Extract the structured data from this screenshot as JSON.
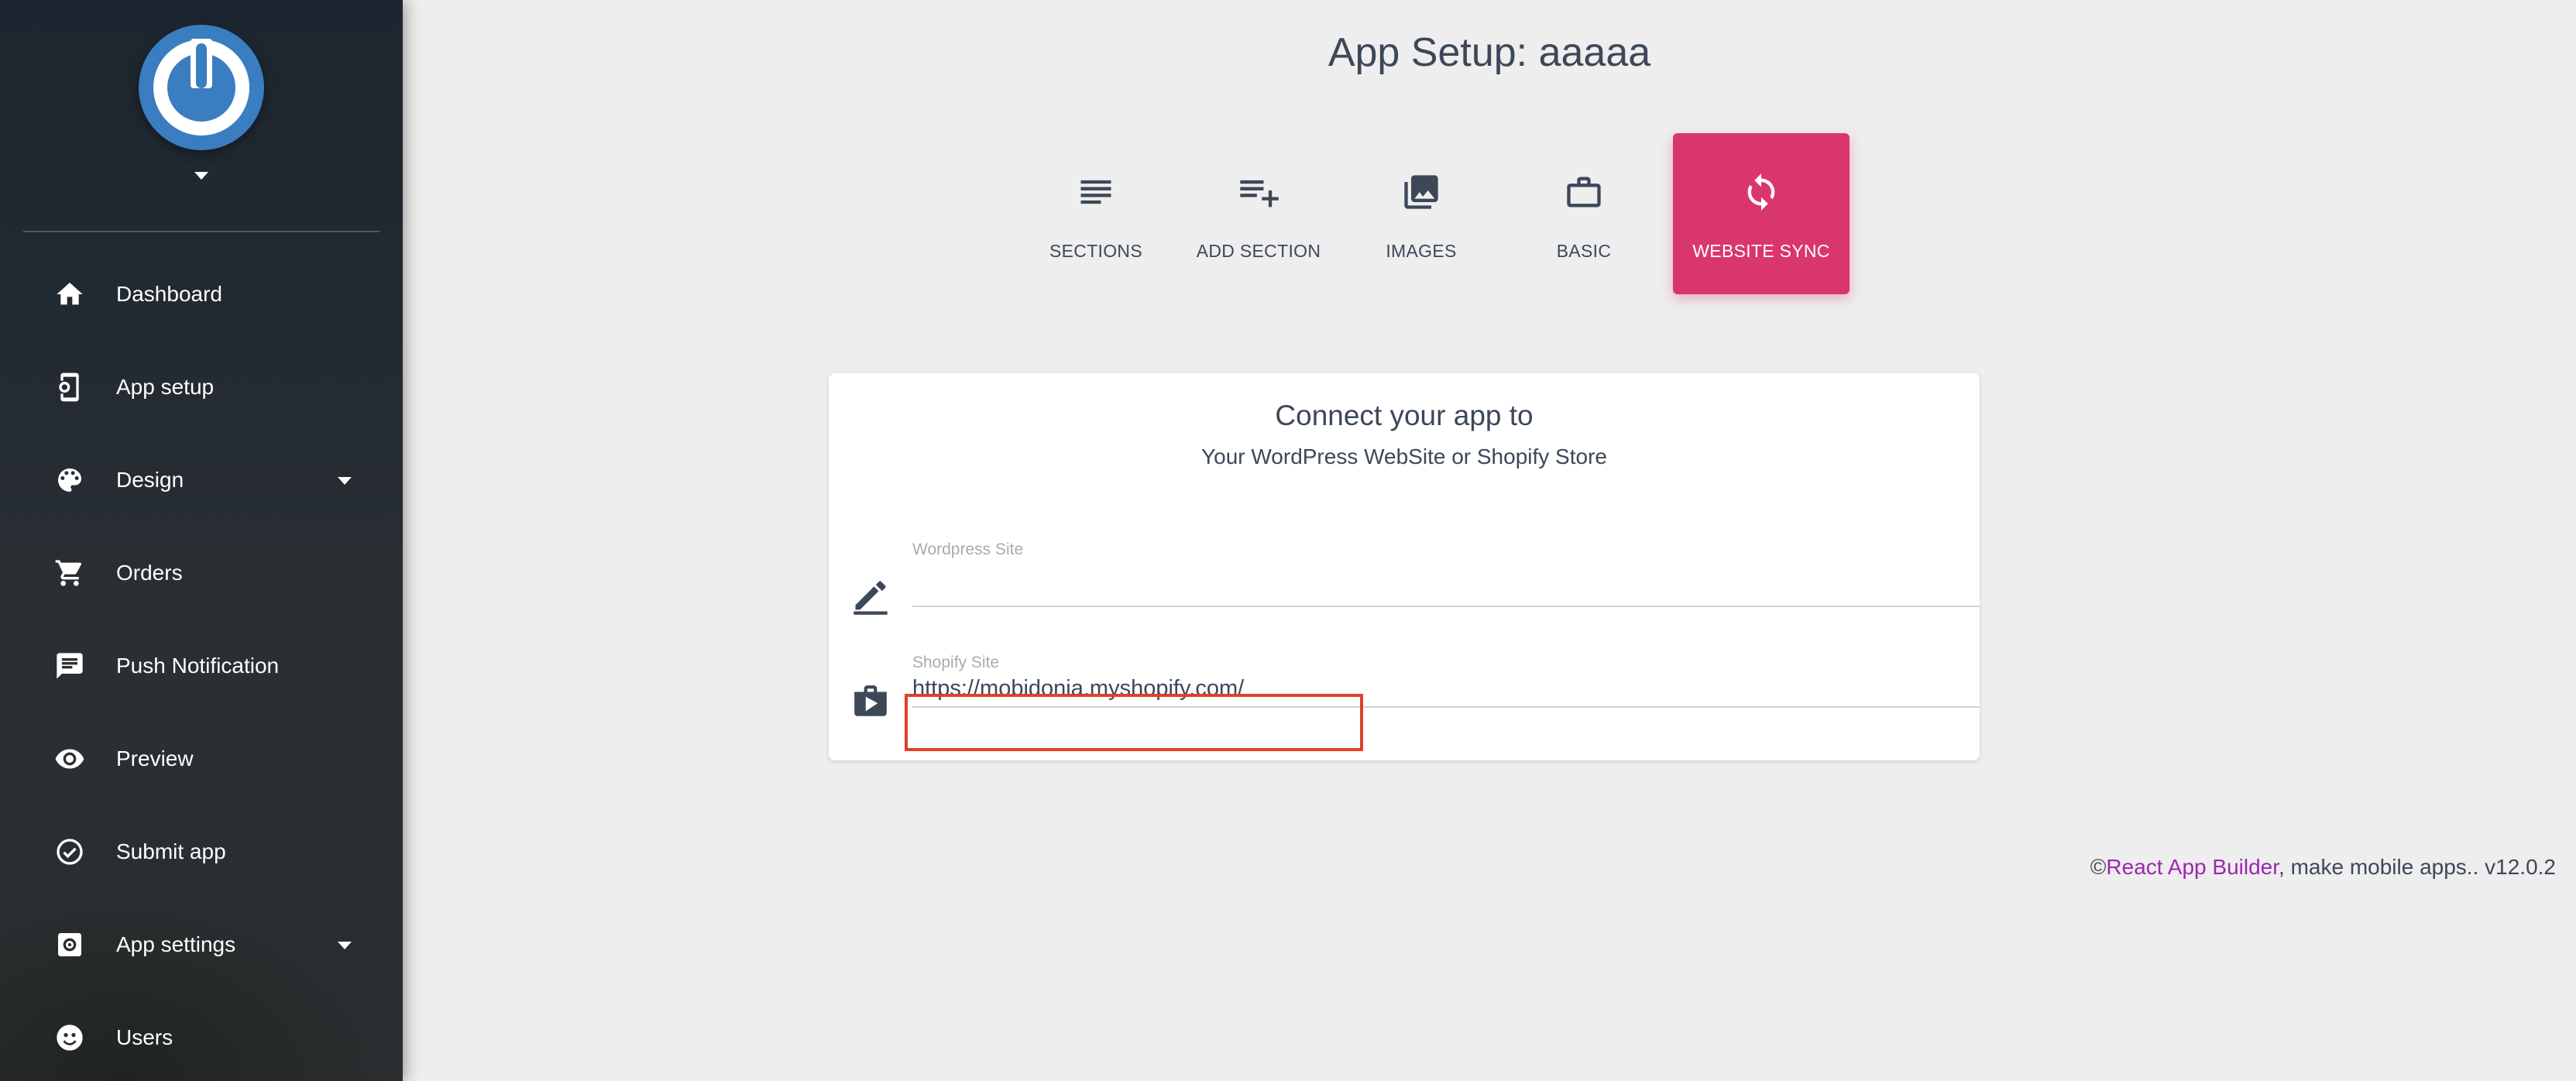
{
  "sidebar": {
    "logo": {
      "icon": "power-icon",
      "color": "#3a7dc0"
    },
    "items": [
      {
        "label": "Dashboard",
        "icon": "home-icon"
      },
      {
        "label": "App setup",
        "icon": "phone-settings-icon"
      },
      {
        "label": "Design",
        "icon": "palette-icon",
        "has_dropdown": true
      },
      {
        "label": "Orders",
        "icon": "cart-icon"
      },
      {
        "label": "Push Notification",
        "icon": "message-icon"
      },
      {
        "label": "Preview",
        "icon": "eye-icon"
      },
      {
        "label": "Submit app",
        "icon": "check-circle-icon"
      },
      {
        "label": "App settings",
        "icon": "settings-box-icon",
        "has_dropdown": true
      },
      {
        "label": "Users",
        "icon": "users-icon"
      }
    ]
  },
  "header": {
    "title": "App Setup: aaaaa"
  },
  "tabs": [
    {
      "label": "SECTIONS",
      "icon": "list-icon",
      "active": false
    },
    {
      "label": "ADD SECTION",
      "icon": "playlist-add-icon",
      "active": false
    },
    {
      "label": "IMAGES",
      "icon": "images-icon",
      "active": false
    },
    {
      "label": "BASIC",
      "icon": "briefcase-icon",
      "active": false
    },
    {
      "label": "WEBSITE SYNC",
      "icon": "sync-icon",
      "active": true
    }
  ],
  "card": {
    "title": "Connect your app to",
    "subtitle": "Your WordPress WebSite or Shopify Store",
    "wordpress": {
      "label": "Wordpress Site",
      "value": "",
      "icon": "pencil-icon"
    },
    "shopify": {
      "label": "Shopify Site",
      "value": "https://mobidonia.myshopify.com/",
      "icon": "shop-icon"
    }
  },
  "footer": {
    "copyright": "©",
    "brand": "React App Builder",
    "text": ", make mobile apps.. v12.0.2"
  },
  "colors": {
    "accent": "#d9376b",
    "brand_link": "#9c27b0",
    "highlight": "#e0402a"
  }
}
